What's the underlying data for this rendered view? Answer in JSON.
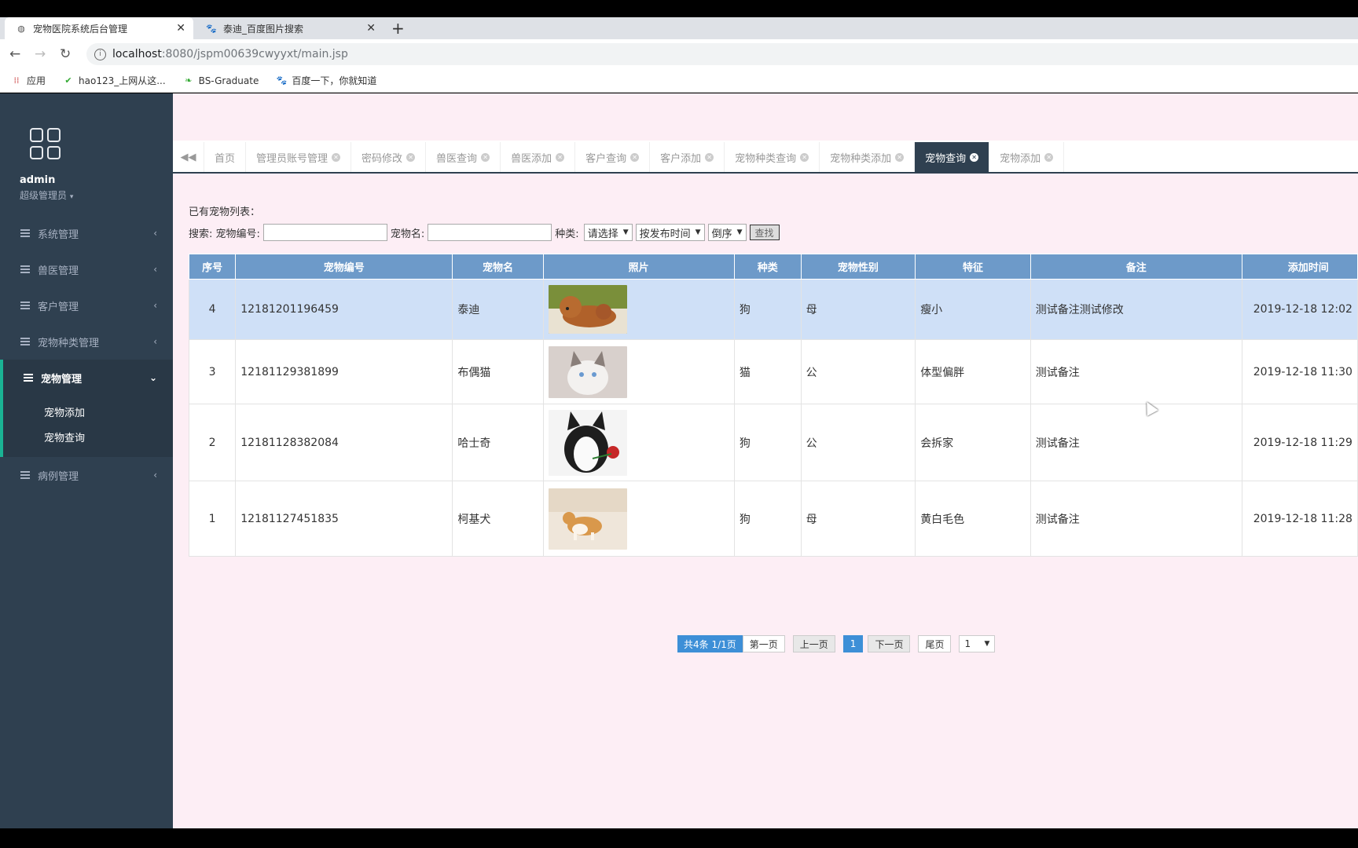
{
  "browser": {
    "tabs": [
      {
        "title": "宠物医院系统后台管理",
        "active": true
      },
      {
        "title": "泰迪_百度图片搜索",
        "active": false
      }
    ],
    "url_host": "localhost",
    "url_path": ":8080/jspm00639cwyyxt/main.jsp",
    "bookmarks": [
      "应用",
      "hao123_上网从这...",
      "BS-Graduate",
      "百度一下，你就知道"
    ]
  },
  "sidebar": {
    "user": "admin",
    "role": "超级管理员",
    "menu": [
      {
        "label": "系统管理"
      },
      {
        "label": "兽医管理"
      },
      {
        "label": "客户管理"
      },
      {
        "label": "宠物种类管理"
      },
      {
        "label": "宠物管理",
        "active": true
      },
      {
        "label": "病例管理"
      }
    ],
    "submenu": [
      "宠物添加",
      "宠物查询"
    ]
  },
  "tabs": [
    {
      "label": "首页"
    },
    {
      "label": "管理员账号管理"
    },
    {
      "label": "密码修改"
    },
    {
      "label": "兽医查询"
    },
    {
      "label": "兽医添加"
    },
    {
      "label": "客户查询"
    },
    {
      "label": "客户添加"
    },
    {
      "label": "宠物种类查询"
    },
    {
      "label": "宠物种类添加"
    },
    {
      "label": "宠物查询",
      "active": true
    },
    {
      "label": "宠物添加"
    }
  ],
  "list": {
    "title": "已有宠物列表：",
    "search_label": "搜索: 宠物编号:",
    "name_label": "宠物名:",
    "type_label": "种类:",
    "type_select": "请选择",
    "sort_select": "按发布时间",
    "order_select": "倒序",
    "search_button": "查找"
  },
  "table": {
    "headers": [
      "序号",
      "宠物编号",
      "宠物名",
      "照片",
      "种类",
      "宠物性别",
      "特征",
      "备注",
      "添加时间"
    ],
    "rows": [
      {
        "no": "4",
        "code": "12181201196459",
        "name": "泰迪",
        "photo": "poodle",
        "type": "狗",
        "sex": "母",
        "feature": "瘦小",
        "note": "测试备注测试修改",
        "time": "2019-12-18 12:02",
        "selected": true
      },
      {
        "no": "3",
        "code": "12181129381899",
        "name": "布偶猫",
        "photo": "ragdoll",
        "type": "猫",
        "sex": "公",
        "feature": "体型偏胖",
        "note": "测试备注",
        "time": "2019-12-18 11:30"
      },
      {
        "no": "2",
        "code": "12181128382084",
        "name": "哈士奇",
        "photo": "husky",
        "type": "狗",
        "sex": "公",
        "feature": "会拆家",
        "note": "测试备注",
        "time": "2019-12-18 11:29"
      },
      {
        "no": "1",
        "code": "12181127451835",
        "name": "柯基犬",
        "photo": "corgi",
        "type": "狗",
        "sex": "母",
        "feature": "黄白毛色",
        "note": "测试备注",
        "time": "2019-12-18 11:28"
      }
    ]
  },
  "pager": {
    "info": "共4条  1/1页",
    "first": "第一页",
    "prev": "上一页",
    "current": "1",
    "next": "下一页",
    "last": "尾页",
    "select": "1"
  },
  "colors": {
    "sidebar": "#2f4050",
    "accent": "#1ab394",
    "header": "#6d9ac9",
    "page_bg": "#fdeef5"
  }
}
